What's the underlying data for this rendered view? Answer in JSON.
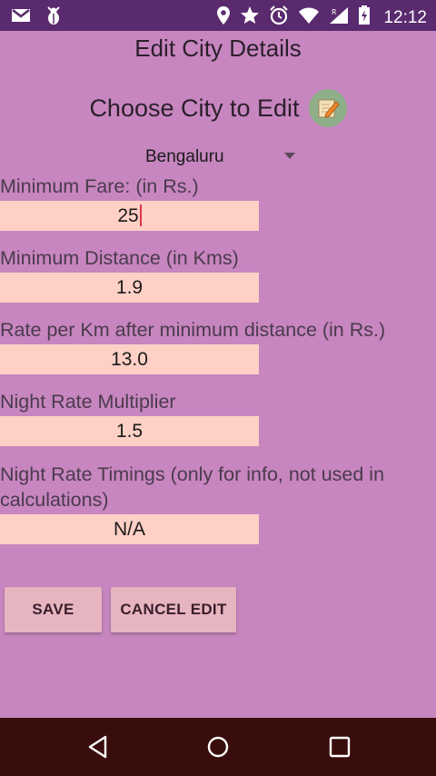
{
  "status_bar": {
    "left_icons": [
      "gmail-icon",
      "bug-icon"
    ],
    "right_icons": [
      "location-icon",
      "star-icon",
      "alarm-icon",
      "wifi-icon",
      "signal-icon",
      "battery-icon"
    ],
    "time": "12:12"
  },
  "screen": {
    "title": "Edit City Details",
    "choose_label": "Choose City to Edit",
    "city_selected": "Bengaluru"
  },
  "fields": {
    "min_fare": {
      "label": "Minimum Fare: (in Rs.)",
      "value": "25"
    },
    "min_distance": {
      "label": "Minimum Distance (in Kms)",
      "value": "1.9"
    },
    "rate_per_km": {
      "label": "Rate per Km after minimum distance (in Rs.)",
      "value": "13.0"
    },
    "night_multiplier": {
      "label": "Night Rate Multiplier",
      "value": "1.5"
    },
    "night_timings": {
      "label_line1": "Night Rate Timings (only for info, not used in",
      "label_line2": "calculations)",
      "value": "N/A"
    }
  },
  "buttons": {
    "save": "SAVE",
    "cancel": "CANCEL EDIT"
  },
  "colors": {
    "background": "#c786bf",
    "status_bar": "#5a2a6e",
    "input_bg": "#ffd0c6",
    "button_bg": "#e6b5c0",
    "nav_bar": "#3a0d0d"
  }
}
